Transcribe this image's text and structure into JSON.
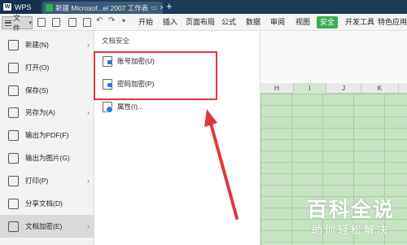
{
  "titlebar": {
    "app_name": "WPS",
    "doc_tab_title": "新建 Microsof...el 2007 工作表",
    "new_tab_label": "+"
  },
  "menubar": {
    "file_label": "文件",
    "tabs": [
      "开始",
      "插入",
      "页面布局",
      "公式",
      "数据",
      "审阅",
      "视图",
      "安全",
      "开发工具",
      "特色应用"
    ],
    "active_tab": "安全"
  },
  "file_menu": {
    "items": [
      {
        "label": "新建(N)",
        "icon": "new-file-icon",
        "has_submenu": true
      },
      {
        "label": "打开(O)",
        "icon": "folder-icon",
        "has_submenu": false
      },
      {
        "label": "保存(S)",
        "icon": "save-icon",
        "has_submenu": false
      },
      {
        "label": "另存为(A)",
        "icon": "save-as-icon",
        "has_submenu": true
      },
      {
        "label": "输出为PDF(F)",
        "icon": "pdf-icon",
        "has_submenu": false
      },
      {
        "label": "输出为图片(G)",
        "icon": "image-icon",
        "has_submenu": false
      },
      {
        "label": "打印(P)",
        "icon": "print-icon",
        "has_submenu": true
      },
      {
        "label": "分享文档(D)",
        "icon": "share-icon",
        "has_submenu": false
      },
      {
        "label": "文档加密(E)",
        "icon": "encrypt-icon",
        "has_submenu": true
      }
    ],
    "selected": "文档加密(E)"
  },
  "security_submenu": {
    "header": "文档安全",
    "items": [
      {
        "label": "账号加密(U)",
        "icon": "account-lock-icon"
      },
      {
        "label": "密码加密(P)",
        "icon": "password-lock-icon"
      },
      {
        "label": "属性(I)...",
        "icon": "properties-icon"
      }
    ]
  },
  "sheet": {
    "columns": [
      "H",
      "I",
      "J",
      "K"
    ],
    "selected_column": "I"
  },
  "watermark": {
    "main": "百科全说",
    "sub": "助你轻松解决"
  },
  "colors": {
    "accent_green": "#3aae54",
    "highlight_red": "#e0373d",
    "sheet_green": "#c7e3c3",
    "titlebar": "#1e3a5a"
  }
}
